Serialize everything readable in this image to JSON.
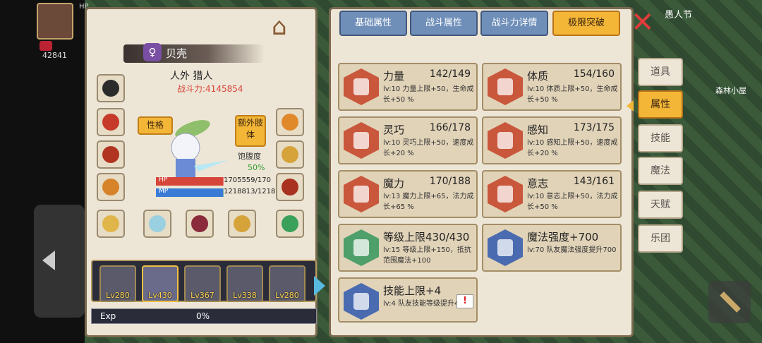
{
  "hud": {
    "player_num": "42841"
  },
  "character": {
    "name": "贝壳",
    "titles": "人外 猎人",
    "power": "战斗力:4145854",
    "trait_button": "性格",
    "extra_limb_button": "额外肢体",
    "satiety_label": "饱腹度",
    "satiety_value": "50%",
    "hp_label": "HP",
    "hp_value": "1705559/170",
    "mp_label": "MP",
    "mp_value": "1218813/1218",
    "hp_fraction": 0.99,
    "mp_fraction": 0.99
  },
  "party": [
    {
      "level": "Lv280"
    },
    {
      "level": "Lv430"
    },
    {
      "level": "Lv367"
    },
    {
      "level": "Lv338"
    },
    {
      "level": "Lv280"
    }
  ],
  "exp": {
    "label": "Exp",
    "value": "0%"
  },
  "tabs": [
    "基础属性",
    "战斗属性",
    "战斗力详情",
    "极限突破"
  ],
  "stats": [
    {
      "name": "力量",
      "value": "142/149",
      "desc": "lv:10 力量上限+50，生命成长+50 %",
      "icon": "strength-icon"
    },
    {
      "name": "体质",
      "value": "154/160",
      "desc": "lv:10 体质上限+50，生命成长+50 %",
      "icon": "constitution-icon"
    },
    {
      "name": "灵巧",
      "value": "166/178",
      "desc": "lv:10 灵巧上限+50，速度成长+20 %",
      "icon": "agility-icon"
    },
    {
      "name": "感知",
      "value": "173/175",
      "desc": "lv:10 感知上限+50，速度成长+20 %",
      "icon": "perception-icon"
    },
    {
      "name": "魔力",
      "value": "170/188",
      "desc": "lv:13 魔力上限+65，法力成长+65 %",
      "icon": "magic-icon"
    },
    {
      "name": "意志",
      "value": "143/161",
      "desc": "lv:10 意志上限+50，法力成长+50 %",
      "icon": "will-icon"
    },
    {
      "name": "等级上限430/430",
      "value": "",
      "desc": "lv:15 等级上限+150，抵抗范围魔法+100",
      "icon": "level-cap-icon"
    },
    {
      "name": "魔法强度+700",
      "value": "",
      "desc": "lv:70 队友魔法强度提升700",
      "icon": "magic-power-icon"
    },
    {
      "name": "技能上限+4",
      "value": "",
      "desc": "lv:4 队友技能等级提升4",
      "icon": "skill-cap-icon"
    }
  ],
  "side_menu": [
    "道具",
    "属性",
    "技能",
    "魔法",
    "天赋",
    "乐团"
  ],
  "map": {
    "event": "愚人节",
    "location": "森林小屋"
  },
  "colors": {
    "accent": "#f3b637",
    "tab_blue": "#6f8fb9",
    "power_red": "#d8443a"
  }
}
